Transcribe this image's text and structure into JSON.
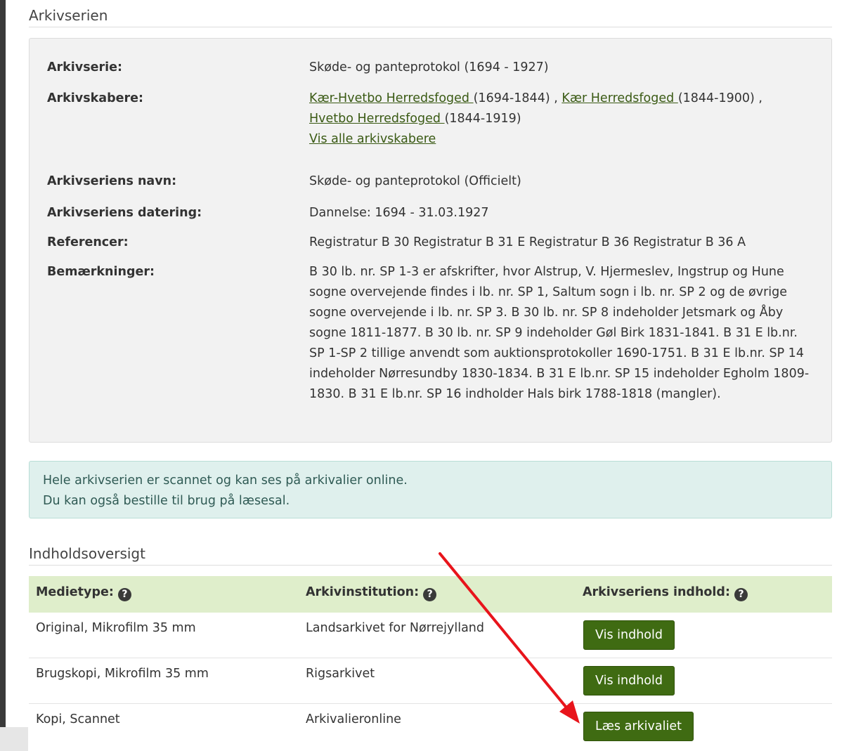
{
  "section1": {
    "title": "Arkivserien"
  },
  "details": {
    "arkivserie": {
      "label": "Arkivserie:",
      "value": "Skøde- og panteprotokol (1694 - 1927)"
    },
    "arkivskabere": {
      "label": "Arkivskabere:",
      "creators": [
        {
          "name": "Kær-Hvetbo Herredsfoged ",
          "years": "(1694-1844) ,"
        },
        {
          "name": "Kær Herredsfoged ",
          "years": "(1844-1900) ,"
        },
        {
          "name": "Hvetbo Herredsfoged ",
          "years": "(1844-1919)"
        }
      ],
      "show_all": "Vis alle arkivskabere"
    },
    "navn": {
      "label": "Arkivseriens navn:",
      "value": "Skøde- og panteprotokol (Officielt)"
    },
    "datering": {
      "label": "Arkivseriens datering:",
      "value": "Dannelse: 1694 - 31.03.1927"
    },
    "referencer": {
      "label": "Referencer:",
      "value": "Registratur B 30 Registratur B 31 E Registratur B 36 Registratur B 36 A"
    },
    "bemaerkninger": {
      "label": "Bemærkninger:",
      "value": "B 30 lb. nr. SP 1-3 er afskrifter, hvor Alstrup, V. Hjermeslev, Ingstrup og Hune sogne overvejende findes i lb. nr. SP 1, Saltum sogn i lb. nr. SP 2 og de øvrige sogne overvejende i lb. nr. SP 3. B 30 lb. nr. SP 8 indeholder Jetsmark og Åby sogne 1811-1877. B 30 lb. nr. SP 9 indeholder Gøl Birk 1831-1841. B 31 E lb.nr. SP 1-SP 2 tillige anvendt som auktionsprotokoller 1690-1751. B 31 E lb.nr. SP 14 indeholder Nørresundby 1830-1834. B 31 E lb.nr. SP 15 indeholder Egholm 1809-1830. B 31 E lb.nr. SP 16 indholder Hals birk 1788-1818 (mangler)."
    }
  },
  "notice": {
    "line1": "Hele arkivserien er scannet og kan ses på arkivalier online.",
    "line2": "Du kan også bestille til brug på læsesal."
  },
  "section2": {
    "title": "Indholdsoversigt"
  },
  "table": {
    "headers": [
      "Medietype:",
      "Arkivinstitution:",
      "Arkivseriens indhold:"
    ],
    "help_icon": "?",
    "rows": [
      {
        "medietype": "Original, Mikrofilm 35 mm",
        "institution": "Landsarkivet for Nørrejylland",
        "button": "Vis indhold"
      },
      {
        "medietype": "Brugskopi, Mikrofilm 35 mm",
        "institution": "Rigsarkivet",
        "button": "Vis indhold"
      },
      {
        "medietype": "Kopi, Scannet",
        "institution": "Arkivalieronline",
        "button": "Læs arkivaliet"
      }
    ]
  },
  "colors": {
    "accent": "#3f6b12",
    "link": "#3a5a14",
    "header_bg": "#dfeecb",
    "notice_bg": "#dff0ed",
    "arrow": "#e8141b"
  },
  "icons": {
    "help": "question-circle-icon",
    "annotation": "red-arrow-icon"
  }
}
